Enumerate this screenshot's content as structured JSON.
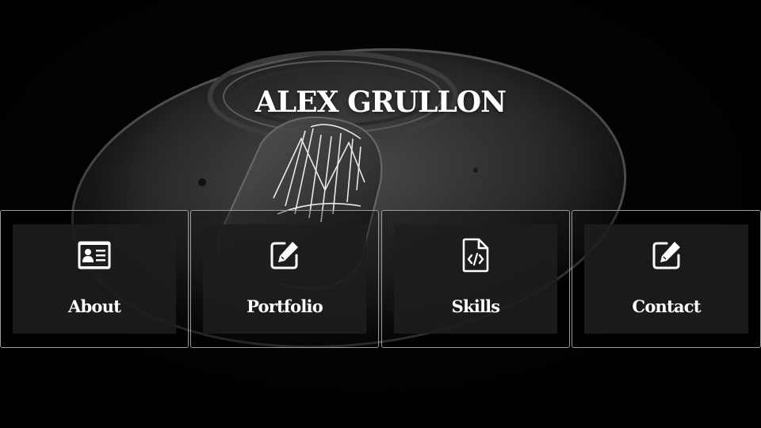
{
  "site": {
    "title": "ALEX GRULLON"
  },
  "nav": {
    "items": [
      {
        "label": "About",
        "icon": "id-card-icon"
      },
      {
        "label": "Portfolio",
        "icon": "edit-icon"
      },
      {
        "label": "Skills",
        "icon": "code-file-icon"
      },
      {
        "label": "Contact",
        "icon": "edit-icon"
      }
    ]
  },
  "colors": {
    "background": "#050505",
    "text": "#ffffff",
    "card_border": "#9a9a9a",
    "card_inner": "#1e1e1e"
  }
}
